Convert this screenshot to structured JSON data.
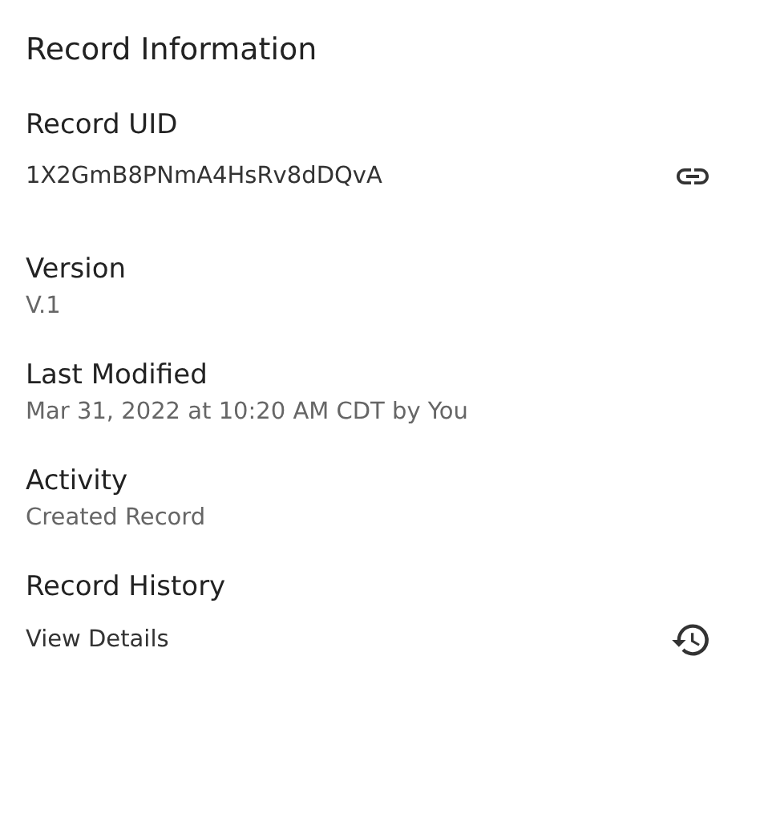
{
  "title": "Record Information",
  "fields": [
    {
      "label": "Record UID",
      "value": "1X2GmB8PNmA4HsRv8dDQvA",
      "kind": "copy-link"
    },
    {
      "label": "Version",
      "value": "V.1",
      "kind": "text"
    },
    {
      "label": "Last Modified",
      "value": "Mar 31, 2022 at 10:20 AM CDT by You",
      "kind": "text"
    },
    {
      "label": "Activity",
      "value": "Created Record",
      "kind": "text"
    },
    {
      "label": "Record History",
      "value": "View Details",
      "kind": "history"
    }
  ]
}
